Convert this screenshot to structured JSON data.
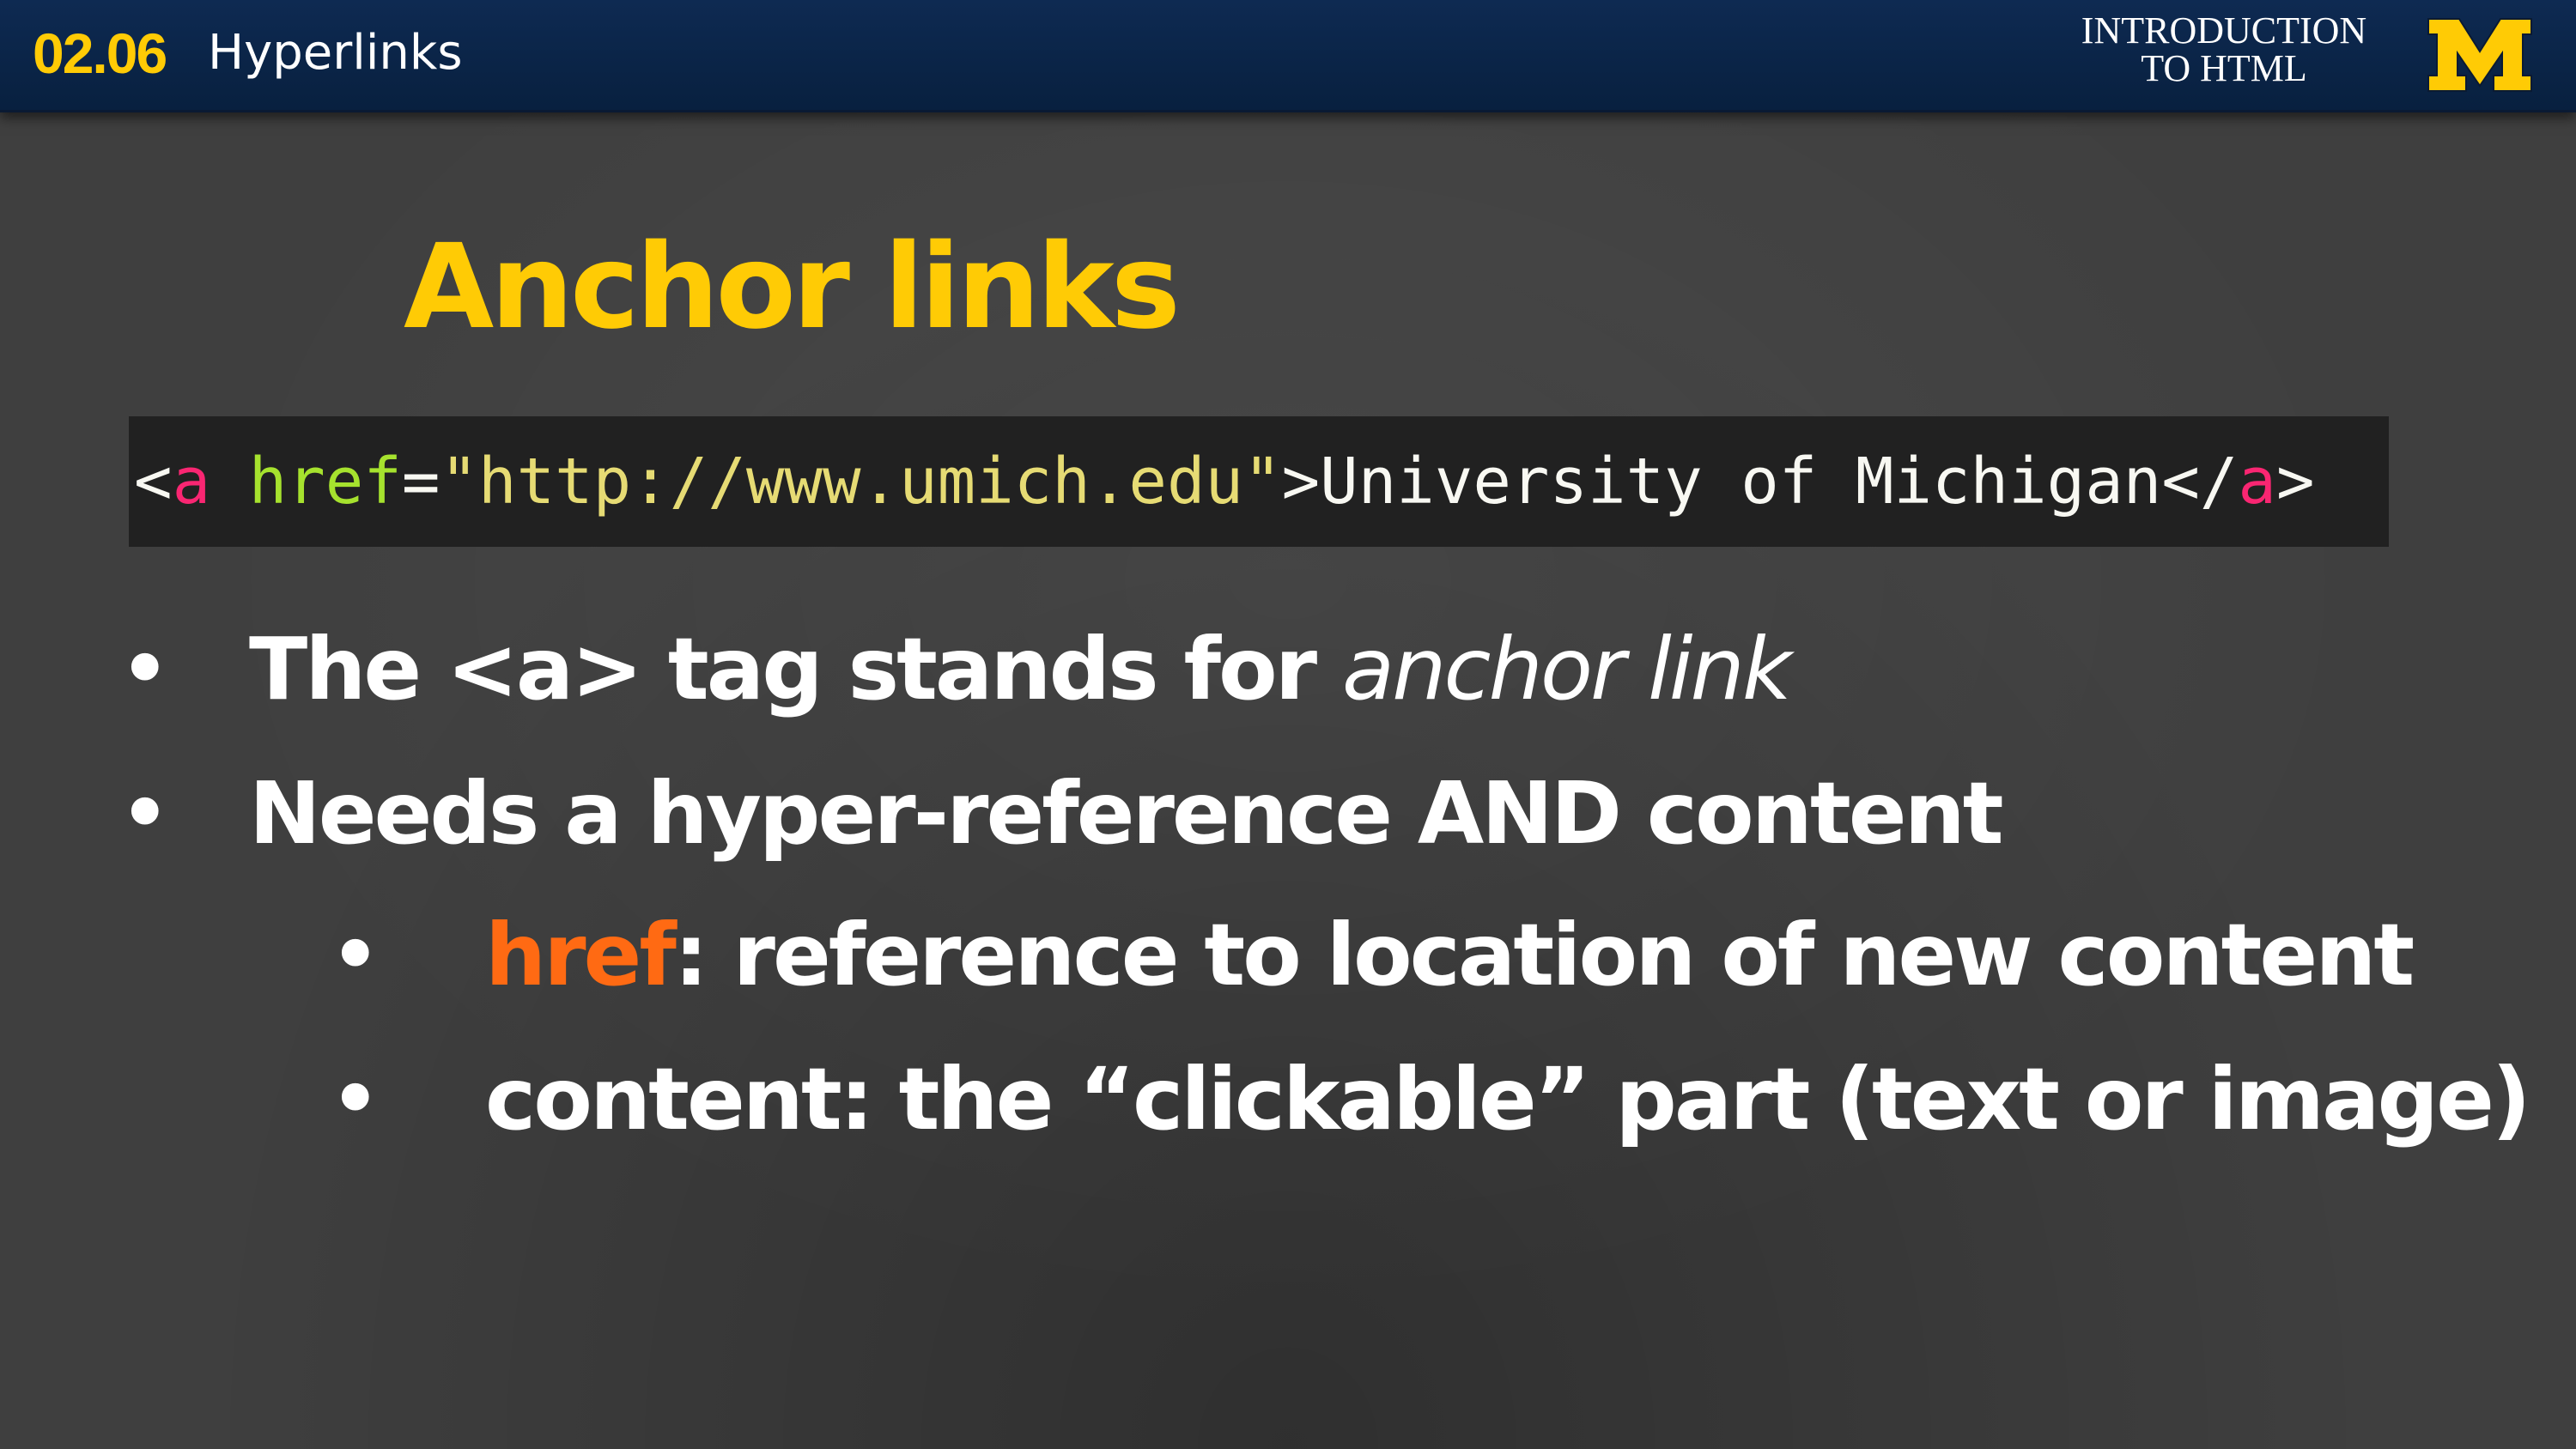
{
  "header": {
    "lesson_number": "02.06",
    "lesson_title": "Hyperlinks",
    "course_line1": "INTRODUCTION",
    "course_line2": "TO HTML",
    "logo_letter": "M",
    "brand_colors": {
      "navy": "#0e2a52",
      "maize": "#ffcb05"
    }
  },
  "slide": {
    "title": "Anchor links",
    "code": {
      "open_bracket": "<",
      "tag_open": "a",
      "space": " ",
      "attr": "href",
      "equals": "=",
      "value": "\"http://www.umich.edu\"",
      "close_bracket": ">",
      "text": "University of Michigan",
      "end_open": "</",
      "tag_close": "a",
      "end_close": ">"
    },
    "bullets": [
      {
        "text": "The <a> tag stands for ",
        "italic": "anchor link"
      },
      {
        "text": "Needs a hyper-reference AND content"
      },
      {
        "highlight": "href",
        "text": ": reference to location of  new content"
      },
      {
        "text": "content: the “clickable” part (text or image)"
      }
    ],
    "bullet_glyph": "•",
    "colors": {
      "highlight": "#ff6a13",
      "code_bg": "#212121"
    }
  }
}
